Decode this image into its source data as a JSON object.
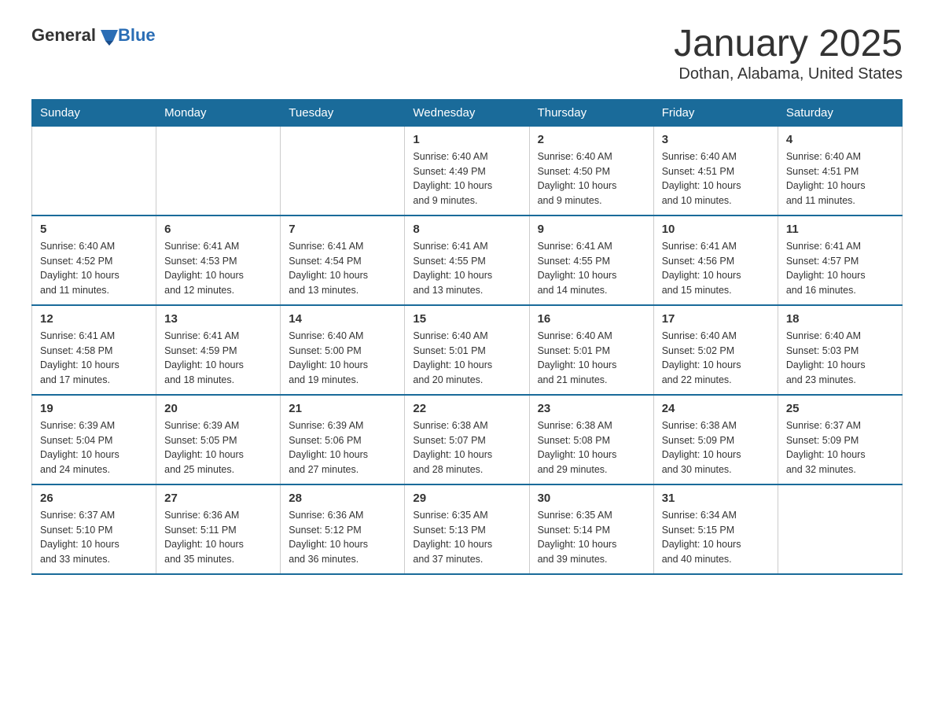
{
  "logo": {
    "text_general": "General",
    "text_blue": "Blue"
  },
  "title": "January 2025",
  "subtitle": "Dothan, Alabama, United States",
  "days_of_week": [
    "Sunday",
    "Monday",
    "Tuesday",
    "Wednesday",
    "Thursday",
    "Friday",
    "Saturday"
  ],
  "weeks": [
    [
      {
        "day": "",
        "info": ""
      },
      {
        "day": "",
        "info": ""
      },
      {
        "day": "",
        "info": ""
      },
      {
        "day": "1",
        "info": "Sunrise: 6:40 AM\nSunset: 4:49 PM\nDaylight: 10 hours\nand 9 minutes."
      },
      {
        "day": "2",
        "info": "Sunrise: 6:40 AM\nSunset: 4:50 PM\nDaylight: 10 hours\nand 9 minutes."
      },
      {
        "day": "3",
        "info": "Sunrise: 6:40 AM\nSunset: 4:51 PM\nDaylight: 10 hours\nand 10 minutes."
      },
      {
        "day": "4",
        "info": "Sunrise: 6:40 AM\nSunset: 4:51 PM\nDaylight: 10 hours\nand 11 minutes."
      }
    ],
    [
      {
        "day": "5",
        "info": "Sunrise: 6:40 AM\nSunset: 4:52 PM\nDaylight: 10 hours\nand 11 minutes."
      },
      {
        "day": "6",
        "info": "Sunrise: 6:41 AM\nSunset: 4:53 PM\nDaylight: 10 hours\nand 12 minutes."
      },
      {
        "day": "7",
        "info": "Sunrise: 6:41 AM\nSunset: 4:54 PM\nDaylight: 10 hours\nand 13 minutes."
      },
      {
        "day": "8",
        "info": "Sunrise: 6:41 AM\nSunset: 4:55 PM\nDaylight: 10 hours\nand 13 minutes."
      },
      {
        "day": "9",
        "info": "Sunrise: 6:41 AM\nSunset: 4:55 PM\nDaylight: 10 hours\nand 14 minutes."
      },
      {
        "day": "10",
        "info": "Sunrise: 6:41 AM\nSunset: 4:56 PM\nDaylight: 10 hours\nand 15 minutes."
      },
      {
        "day": "11",
        "info": "Sunrise: 6:41 AM\nSunset: 4:57 PM\nDaylight: 10 hours\nand 16 minutes."
      }
    ],
    [
      {
        "day": "12",
        "info": "Sunrise: 6:41 AM\nSunset: 4:58 PM\nDaylight: 10 hours\nand 17 minutes."
      },
      {
        "day": "13",
        "info": "Sunrise: 6:41 AM\nSunset: 4:59 PM\nDaylight: 10 hours\nand 18 minutes."
      },
      {
        "day": "14",
        "info": "Sunrise: 6:40 AM\nSunset: 5:00 PM\nDaylight: 10 hours\nand 19 minutes."
      },
      {
        "day": "15",
        "info": "Sunrise: 6:40 AM\nSunset: 5:01 PM\nDaylight: 10 hours\nand 20 minutes."
      },
      {
        "day": "16",
        "info": "Sunrise: 6:40 AM\nSunset: 5:01 PM\nDaylight: 10 hours\nand 21 minutes."
      },
      {
        "day": "17",
        "info": "Sunrise: 6:40 AM\nSunset: 5:02 PM\nDaylight: 10 hours\nand 22 minutes."
      },
      {
        "day": "18",
        "info": "Sunrise: 6:40 AM\nSunset: 5:03 PM\nDaylight: 10 hours\nand 23 minutes."
      }
    ],
    [
      {
        "day": "19",
        "info": "Sunrise: 6:39 AM\nSunset: 5:04 PM\nDaylight: 10 hours\nand 24 minutes."
      },
      {
        "day": "20",
        "info": "Sunrise: 6:39 AM\nSunset: 5:05 PM\nDaylight: 10 hours\nand 25 minutes."
      },
      {
        "day": "21",
        "info": "Sunrise: 6:39 AM\nSunset: 5:06 PM\nDaylight: 10 hours\nand 27 minutes."
      },
      {
        "day": "22",
        "info": "Sunrise: 6:38 AM\nSunset: 5:07 PM\nDaylight: 10 hours\nand 28 minutes."
      },
      {
        "day": "23",
        "info": "Sunrise: 6:38 AM\nSunset: 5:08 PM\nDaylight: 10 hours\nand 29 minutes."
      },
      {
        "day": "24",
        "info": "Sunrise: 6:38 AM\nSunset: 5:09 PM\nDaylight: 10 hours\nand 30 minutes."
      },
      {
        "day": "25",
        "info": "Sunrise: 6:37 AM\nSunset: 5:09 PM\nDaylight: 10 hours\nand 32 minutes."
      }
    ],
    [
      {
        "day": "26",
        "info": "Sunrise: 6:37 AM\nSunset: 5:10 PM\nDaylight: 10 hours\nand 33 minutes."
      },
      {
        "day": "27",
        "info": "Sunrise: 6:36 AM\nSunset: 5:11 PM\nDaylight: 10 hours\nand 35 minutes."
      },
      {
        "day": "28",
        "info": "Sunrise: 6:36 AM\nSunset: 5:12 PM\nDaylight: 10 hours\nand 36 minutes."
      },
      {
        "day": "29",
        "info": "Sunrise: 6:35 AM\nSunset: 5:13 PM\nDaylight: 10 hours\nand 37 minutes."
      },
      {
        "day": "30",
        "info": "Sunrise: 6:35 AM\nSunset: 5:14 PM\nDaylight: 10 hours\nand 39 minutes."
      },
      {
        "day": "31",
        "info": "Sunrise: 6:34 AM\nSunset: 5:15 PM\nDaylight: 10 hours\nand 40 minutes."
      },
      {
        "day": "",
        "info": ""
      }
    ]
  ]
}
